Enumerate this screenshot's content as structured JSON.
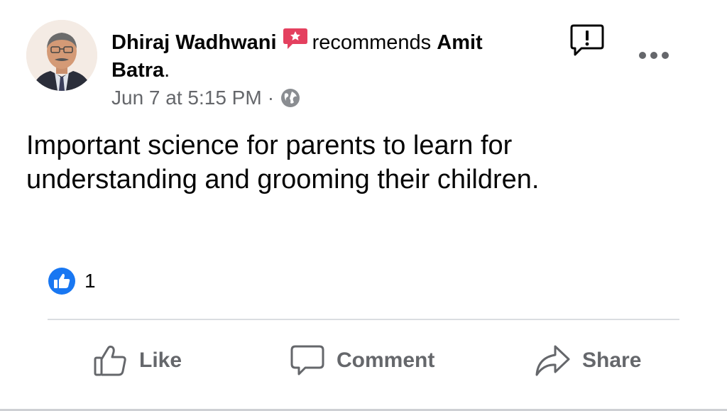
{
  "post": {
    "author": "Dhiraj Wadhwani",
    "action_word": "recommends",
    "recommended_name_line1": "Amit",
    "recommended_name_line2": "Batra",
    "recommended_period": ".",
    "timestamp": "Jun 7 at 5:15 PM",
    "separator": "·",
    "audience_icon": "globe-icon",
    "text_line1": "Important science for parents to learn for",
    "text_line2": "understanding and grooming their children."
  },
  "icons": {
    "recommend": "recommend-icon",
    "report": "report-icon",
    "more": "more-options-icon",
    "like_reaction": "like-reaction-icon"
  },
  "reactions": {
    "count": "1"
  },
  "actions": {
    "like_label": "Like",
    "comment_label": "Comment",
    "share_label": "Share"
  },
  "colors": {
    "text_primary": "#050505",
    "text_secondary": "#65676b",
    "like_blue": "#1877f2",
    "recommend_red": "#e4405f",
    "divider": "#dadde1"
  }
}
